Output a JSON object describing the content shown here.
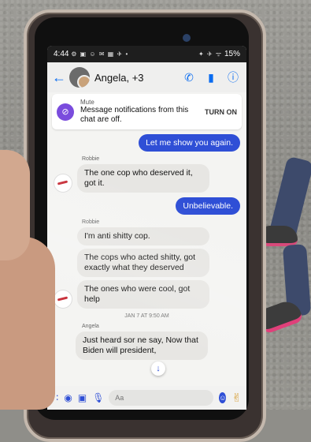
{
  "status_bar": {
    "time": "4:44",
    "icons": "⚙ ▣ ☺ ✉ ▦ ✈ •",
    "right_icons": "✦ ✈ ᯤ",
    "battery": "15%"
  },
  "header": {
    "title": "Angela, +3"
  },
  "mute_banner": {
    "title": "Mute",
    "message": "Message notifications from this chat are off.",
    "action": "TURN ON"
  },
  "messages": {
    "out1": "Let me show you again.",
    "sender1": "Robbie",
    "in1": "The one cop who deserved it, got it.",
    "out2": "Unbelievable.",
    "sender2": "Robbie",
    "in2a": "I'm anti shitty cop.",
    "in2b": "The cops who acted shitty, got exactly what they deserved",
    "in2c": "The ones who were cool, got help",
    "timestamp": "JAN 7 AT 9:50 AM",
    "sender3": "Angela",
    "in3": "Just heard sor   ne say, Now that Biden will    president,"
  },
  "composer": {
    "placeholder": "Aa"
  },
  "colors": {
    "accent": "#2f4fd6",
    "mute_icon": "#7a4cdd"
  }
}
